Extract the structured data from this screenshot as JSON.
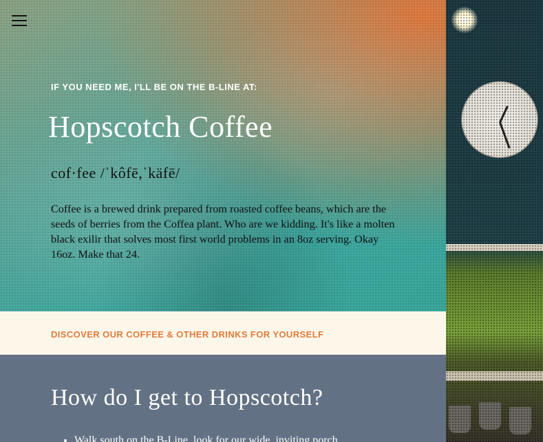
{
  "nav": {
    "menu_icon": "hamburger-menu-icon"
  },
  "hero": {
    "eyebrow": "IF YOU NEED ME, I'LL BE ON THE B-LINE AT:",
    "title": "Hopscotch Coffee",
    "pronunciation": "cof·fee /ˈkôfē,ˈkäfē/",
    "description": "Coffee is a brewed drink prepared from roasted coffee beans, which are the seeds of berries from the Coffea plant. Who are we kidding. It's like a molten black exilir that solves most first world problems in an 8oz serving. Okay 16oz. Make that 24."
  },
  "banner": {
    "link_label": "DISCOVER OUR COFFEE & OTHER DRINKS FOR YOURSELF"
  },
  "directions": {
    "heading": "How do I get to Hopscotch?",
    "items": [
      "Walk south on the B-Line, look for our wide, inviting porch"
    ]
  },
  "colors": {
    "accent_orange": "#e07b3c",
    "banner_cream": "#fdf7ea",
    "section_slate": "#637184",
    "hero_teal": "#3fa8a0"
  }
}
